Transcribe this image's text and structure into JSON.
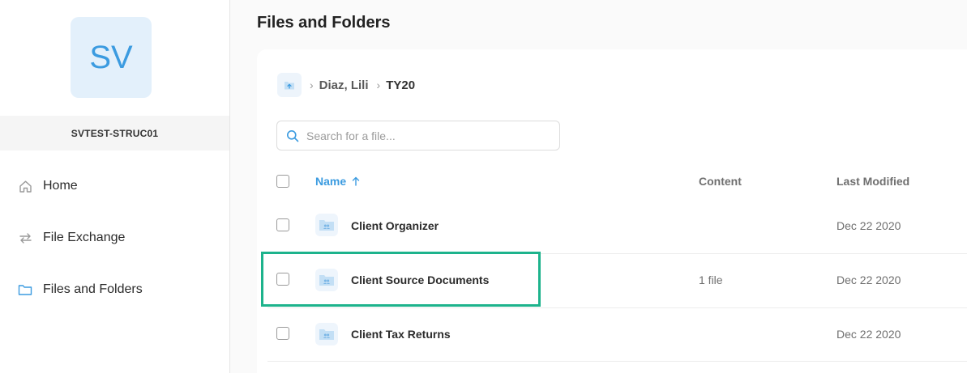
{
  "sidebar": {
    "avatar_initials": "SV",
    "account_name": "SVTEST-STRUC01",
    "items": [
      {
        "label": "Home",
        "icon": "home-icon"
      },
      {
        "label": "File Exchange",
        "icon": "exchange-icon"
      },
      {
        "label": "Files and Folders",
        "icon": "folder-icon"
      }
    ]
  },
  "main": {
    "title": "Files and Folders",
    "breadcrumb": {
      "home_icon": "folder-upload-icon",
      "items": [
        "Diaz, Lili",
        "TY20"
      ]
    },
    "search": {
      "placeholder": "Search for a file..."
    },
    "table": {
      "columns": {
        "name": "Name",
        "content": "Content",
        "last_modified": "Last Modified"
      },
      "rows": [
        {
          "name": "Client Organizer",
          "content": "",
          "last_modified": "Dec 22 2020"
        },
        {
          "name": "Client Source Documents",
          "content": "1 file",
          "last_modified": "Dec 22 2020"
        },
        {
          "name": "Client Tax Returns",
          "content": "",
          "last_modified": "Dec 22 2020"
        }
      ]
    }
  },
  "colors": {
    "accent": "#3b9be0",
    "highlight": "#1db38c",
    "folder_fill": "#c3dff5"
  }
}
